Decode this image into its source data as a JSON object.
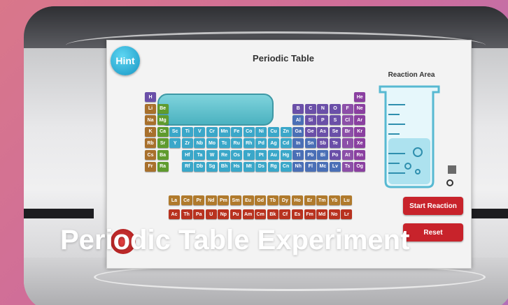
{
  "board": {
    "title": "Periodic Table",
    "hint_label": "Hint",
    "reaction_area_label": "Reaction Area"
  },
  "buttons": {
    "start_reaction": "Start Reaction",
    "reset": "Reset"
  },
  "caption": "Periodic Table Experiment",
  "colors": {
    "alkali": "#a8702c",
    "alkaline": "#5f9b2e",
    "transition": "#3aa7c9",
    "post_transition": "#4a6fb6",
    "nonmetal": "#6a4fa8",
    "halogen": "#8c4fa8",
    "noble": "#8a3fa0",
    "lanthanide": "#b07a2c",
    "actinide": "#b8321f",
    "hydrogen": "#6a4fa8",
    "button_red": "#c8232b"
  },
  "elements": [
    {
      "s": "H",
      "c": "hydrogen",
      "r": 0,
      "col": 0
    },
    {
      "s": "He",
      "c": "noble",
      "r": 0,
      "col": 17
    },
    {
      "s": "Li",
      "c": "alkali",
      "r": 1,
      "col": 0
    },
    {
      "s": "Be",
      "c": "alkaline",
      "r": 1,
      "col": 1
    },
    {
      "s": "B",
      "c": "nonmetal",
      "r": 1,
      "col": 12
    },
    {
      "s": "C",
      "c": "nonmetal",
      "r": 1,
      "col": 13
    },
    {
      "s": "N",
      "c": "nonmetal",
      "r": 1,
      "col": 14
    },
    {
      "s": "O",
      "c": "nonmetal",
      "r": 1,
      "col": 15
    },
    {
      "s": "F",
      "c": "halogen",
      "r": 1,
      "col": 16
    },
    {
      "s": "Ne",
      "c": "noble",
      "r": 1,
      "col": 17
    },
    {
      "s": "Na",
      "c": "alkali",
      "r": 2,
      "col": 0
    },
    {
      "s": "Mg",
      "c": "alkaline",
      "r": 2,
      "col": 1
    },
    {
      "s": "Al",
      "c": "post_transition",
      "r": 2,
      "col": 12
    },
    {
      "s": "Si",
      "c": "nonmetal",
      "r": 2,
      "col": 13
    },
    {
      "s": "P",
      "c": "nonmetal",
      "r": 2,
      "col": 14
    },
    {
      "s": "S",
      "c": "nonmetal",
      "r": 2,
      "col": 15
    },
    {
      "s": "Cl",
      "c": "halogen",
      "r": 2,
      "col": 16
    },
    {
      "s": "Ar",
      "c": "noble",
      "r": 2,
      "col": 17
    },
    {
      "s": "K",
      "c": "alkali",
      "r": 3,
      "col": 0
    },
    {
      "s": "Ca",
      "c": "alkaline",
      "r": 3,
      "col": 1
    },
    {
      "s": "Sc",
      "c": "transition",
      "r": 3,
      "col": 2
    },
    {
      "s": "Ti",
      "c": "transition",
      "r": 3,
      "col": 3
    },
    {
      "s": "V",
      "c": "transition",
      "r": 3,
      "col": 4
    },
    {
      "s": "Cr",
      "c": "transition",
      "r": 3,
      "col": 5
    },
    {
      "s": "Mn",
      "c": "transition",
      "r": 3,
      "col": 6
    },
    {
      "s": "Fe",
      "c": "transition",
      "r": 3,
      "col": 7
    },
    {
      "s": "Co",
      "c": "transition",
      "r": 3,
      "col": 8
    },
    {
      "s": "Ni",
      "c": "transition",
      "r": 3,
      "col": 9
    },
    {
      "s": "Cu",
      "c": "transition",
      "r": 3,
      "col": 10
    },
    {
      "s": "Zn",
      "c": "transition",
      "r": 3,
      "col": 11
    },
    {
      "s": "Ga",
      "c": "post_transition",
      "r": 3,
      "col": 12
    },
    {
      "s": "Ge",
      "c": "nonmetal",
      "r": 3,
      "col": 13
    },
    {
      "s": "As",
      "c": "nonmetal",
      "r": 3,
      "col": 14
    },
    {
      "s": "Se",
      "c": "nonmetal",
      "r": 3,
      "col": 15
    },
    {
      "s": "Br",
      "c": "halogen",
      "r": 3,
      "col": 16
    },
    {
      "s": "Kr",
      "c": "noble",
      "r": 3,
      "col": 17
    },
    {
      "s": "Rb",
      "c": "alkali",
      "r": 4,
      "col": 0
    },
    {
      "s": "Sr",
      "c": "alkaline",
      "r": 4,
      "col": 1
    },
    {
      "s": "Y",
      "c": "transition",
      "r": 4,
      "col": 2
    },
    {
      "s": "Zr",
      "c": "transition",
      "r": 4,
      "col": 3
    },
    {
      "s": "Nb",
      "c": "transition",
      "r": 4,
      "col": 4
    },
    {
      "s": "Mo",
      "c": "transition",
      "r": 4,
      "col": 5
    },
    {
      "s": "Tc",
      "c": "transition",
      "r": 4,
      "col": 6
    },
    {
      "s": "Ru",
      "c": "transition",
      "r": 4,
      "col": 7
    },
    {
      "s": "Rh",
      "c": "transition",
      "r": 4,
      "col": 8
    },
    {
      "s": "Pd",
      "c": "transition",
      "r": 4,
      "col": 9
    },
    {
      "s": "Ag",
      "c": "transition",
      "r": 4,
      "col": 10
    },
    {
      "s": "Cd",
      "c": "transition",
      "r": 4,
      "col": 11
    },
    {
      "s": "In",
      "c": "post_transition",
      "r": 4,
      "col": 12
    },
    {
      "s": "Sn",
      "c": "post_transition",
      "r": 4,
      "col": 13
    },
    {
      "s": "Sb",
      "c": "nonmetal",
      "r": 4,
      "col": 14
    },
    {
      "s": "Te",
      "c": "nonmetal",
      "r": 4,
      "col": 15
    },
    {
      "s": "I",
      "c": "halogen",
      "r": 4,
      "col": 16
    },
    {
      "s": "Xe",
      "c": "noble",
      "r": 4,
      "col": 17
    },
    {
      "s": "Cs",
      "c": "alkali",
      "r": 5,
      "col": 0
    },
    {
      "s": "Ba",
      "c": "alkaline",
      "r": 5,
      "col": 1
    },
    {
      "s": "Hf",
      "c": "transition",
      "r": 5,
      "col": 3
    },
    {
      "s": "Ta",
      "c": "transition",
      "r": 5,
      "col": 4
    },
    {
      "s": "W",
      "c": "transition",
      "r": 5,
      "col": 5
    },
    {
      "s": "Re",
      "c": "transition",
      "r": 5,
      "col": 6
    },
    {
      "s": "Os",
      "c": "transition",
      "r": 5,
      "col": 7
    },
    {
      "s": "Ir",
      "c": "transition",
      "r": 5,
      "col": 8
    },
    {
      "s": "Pt",
      "c": "transition",
      "r": 5,
      "col": 9
    },
    {
      "s": "Au",
      "c": "transition",
      "r": 5,
      "col": 10
    },
    {
      "s": "Hg",
      "c": "transition",
      "r": 5,
      "col": 11
    },
    {
      "s": "Tl",
      "c": "post_transition",
      "r": 5,
      "col": 12
    },
    {
      "s": "Pb",
      "c": "post_transition",
      "r": 5,
      "col": 13
    },
    {
      "s": "Bi",
      "c": "post_transition",
      "r": 5,
      "col": 14
    },
    {
      "s": "Po",
      "c": "nonmetal",
      "r": 5,
      "col": 15
    },
    {
      "s": "At",
      "c": "halogen",
      "r": 5,
      "col": 16
    },
    {
      "s": "Rn",
      "c": "noble",
      "r": 5,
      "col": 17
    },
    {
      "s": "Fr",
      "c": "alkali",
      "r": 6,
      "col": 0
    },
    {
      "s": "Ra",
      "c": "alkaline",
      "r": 6,
      "col": 1
    },
    {
      "s": "Rf",
      "c": "transition",
      "r": 6,
      "col": 3
    },
    {
      "s": "Db",
      "c": "transition",
      "r": 6,
      "col": 4
    },
    {
      "s": "Sg",
      "c": "transition",
      "r": 6,
      "col": 5
    },
    {
      "s": "Bh",
      "c": "transition",
      "r": 6,
      "col": 6
    },
    {
      "s": "Hs",
      "c": "transition",
      "r": 6,
      "col": 7
    },
    {
      "s": "Mt",
      "c": "transition",
      "r": 6,
      "col": 8
    },
    {
      "s": "Ds",
      "c": "transition",
      "r": 6,
      "col": 9
    },
    {
      "s": "Rg",
      "c": "transition",
      "r": 6,
      "col": 10
    },
    {
      "s": "Cn",
      "c": "transition",
      "r": 6,
      "col": 11
    },
    {
      "s": "Nh",
      "c": "post_transition",
      "r": 6,
      "col": 12
    },
    {
      "s": "Fl",
      "c": "post_transition",
      "r": 6,
      "col": 13
    },
    {
      "s": "Mc",
      "c": "post_transition",
      "r": 6,
      "col": 14
    },
    {
      "s": "Lv",
      "c": "post_transition",
      "r": 6,
      "col": 15
    },
    {
      "s": "Ts",
      "c": "halogen",
      "r": 6,
      "col": 16
    },
    {
      "s": "Og",
      "c": "noble",
      "r": 6,
      "col": 17
    }
  ],
  "lanthanides": [
    "La",
    "Ce",
    "Pr",
    "Nd",
    "Pm",
    "Sm",
    "Eu",
    "Gd",
    "Tb",
    "Dy",
    "Ho",
    "Er",
    "Tm",
    "Yb",
    "Lu"
  ],
  "actinides": [
    "Ac",
    "Th",
    "Pa",
    "U",
    "Np",
    "Pu",
    "Am",
    "Cm",
    "Bk",
    "Cf",
    "Es",
    "Fm",
    "Md",
    "No",
    "Lr"
  ]
}
